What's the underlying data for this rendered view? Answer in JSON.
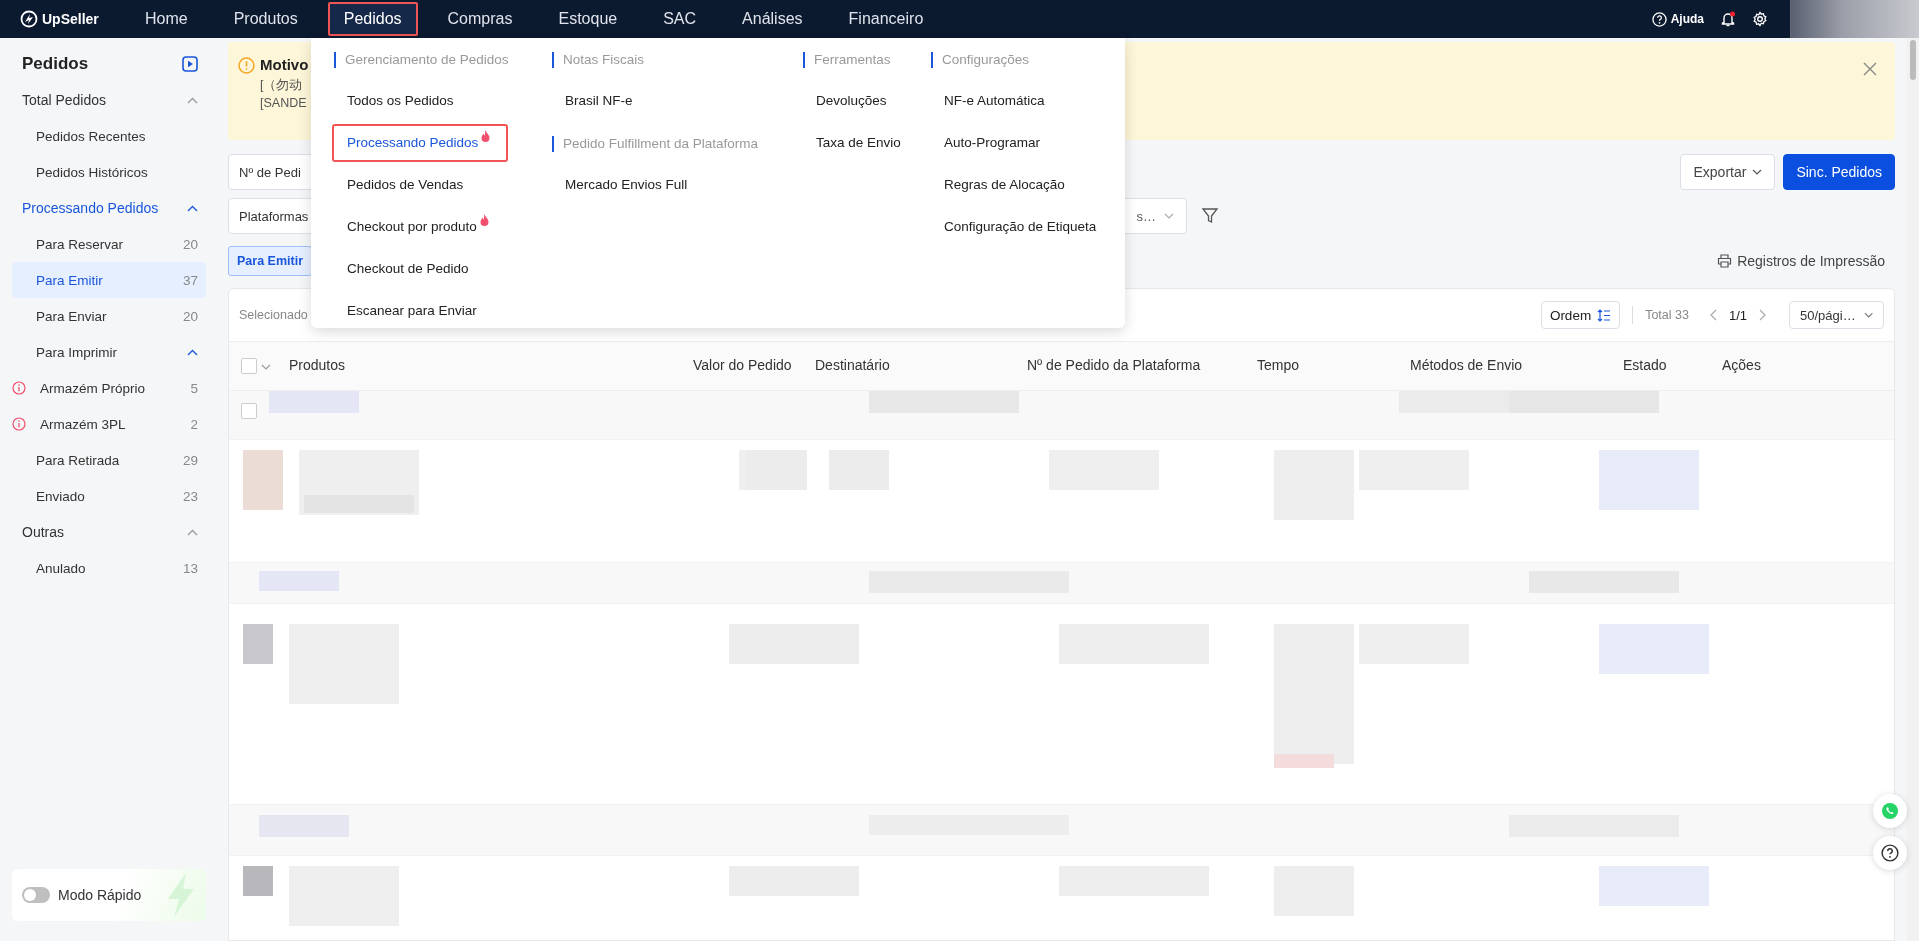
{
  "topbar": {
    "logo": "UpSeller",
    "nav": [
      {
        "label": "Home",
        "selected": false
      },
      {
        "label": "Produtos",
        "selected": false
      },
      {
        "label": "Pedidos",
        "selected": true
      },
      {
        "label": "Compras",
        "selected": false
      },
      {
        "label": "Estoque",
        "selected": false
      },
      {
        "label": "SAC",
        "selected": false
      },
      {
        "label": "Análises",
        "selected": false
      },
      {
        "label": "Financeiro",
        "selected": false
      }
    ],
    "help": "Ajuda",
    "notification_dot": true
  },
  "sidebar": {
    "title": "Pedidos",
    "groups": [
      {
        "label": "Total Pedidos",
        "active": false,
        "expanded": true,
        "children": [
          {
            "label": "Pedidos Recentes",
            "selected": false
          },
          {
            "label": "Pedidos Históricos",
            "selected": false
          }
        ]
      },
      {
        "label": "Processando Pedidos",
        "active": true,
        "expanded": true,
        "children": [
          {
            "label": "Para Reservar",
            "count": "20",
            "selected": false
          },
          {
            "label": "Para Emitir",
            "count": "37",
            "selected": true
          },
          {
            "label": "Para Enviar",
            "count": "20",
            "selected": false
          },
          {
            "label": "Para Imprimir",
            "selected": false,
            "expanded": true,
            "children": [
              {
                "label": "Armazém Próprio",
                "count": "5",
                "warning": true
              },
              {
                "label": "Armazém 3PL",
                "count": "2",
                "warning": true
              }
            ]
          },
          {
            "label": "Para Retirada",
            "count": "29",
            "selected": false
          },
          {
            "label": "Enviado",
            "count": "23",
            "selected": false
          }
        ]
      },
      {
        "label": "Outras",
        "active": false,
        "expanded": true,
        "children": [
          {
            "label": "Anulado",
            "count": "13",
            "selected": false
          }
        ]
      }
    ],
    "quick_mode": {
      "label": "Modo Rápido",
      "on": false
    }
  },
  "banner": {
    "title": "Motivo",
    "lines": [
      "[（勿动",
      "[SANDE"
    ]
  },
  "mega_menu": {
    "columns": [
      {
        "sections": [
          {
            "heading": "Gerenciamento de Pedidos",
            "items": [
              {
                "label": "Todos os Pedidos",
                "selected": false,
                "hot": false
              },
              {
                "label": "Processando Pedidos",
                "selected": true,
                "hot": true
              },
              {
                "label": "Pedidos de Vendas",
                "selected": false,
                "hot": false
              },
              {
                "label": "Checkout por produto",
                "selected": false,
                "hot": true
              },
              {
                "label": "Checkout de Pedido",
                "selected": false,
                "hot": false
              },
              {
                "label": "Escanear para Enviar",
                "selected": false,
                "hot": false
              }
            ]
          }
        ]
      },
      {
        "sections": [
          {
            "heading": "Notas Fiscais",
            "items": [
              {
                "label": "Brasil NF-e",
                "selected": false,
                "hot": false
              }
            ]
          },
          {
            "heading": "Pedido Fulfillment da Plataforma",
            "items": [
              {
                "label": "Mercado Envios Full",
                "selected": false,
                "hot": false
              }
            ]
          }
        ]
      },
      {
        "sections": [
          {
            "heading": "Ferramentas",
            "items": [
              {
                "label": "Devoluções",
                "selected": false,
                "hot": false
              },
              {
                "label": "Taxa de Envio",
                "selected": false,
                "hot": false
              }
            ]
          }
        ]
      },
      {
        "sections": [
          {
            "heading": "Configurações",
            "items": [
              {
                "label": "NF-e Automática",
                "selected": false,
                "hot": false
              },
              {
                "label": "Auto-Programar",
                "selected": false,
                "hot": false
              },
              {
                "label": "Regras de Alocação",
                "selected": false,
                "hot": false
              },
              {
                "label": "Configuração de Etiqueta",
                "selected": false,
                "hot": false
              }
            ]
          }
        ]
      }
    ]
  },
  "toolbar": {
    "order_search": "Nº de Pedi",
    "platforms": "Plataformas",
    "select_tail": "s…",
    "export": "Exportar",
    "sync": "Sinc. Pedidos"
  },
  "status_tabs": [
    {
      "label": "Para Emitir",
      "selected": true
    }
  ],
  "print_log": "Registros de Impressão",
  "table": {
    "header_checked": false,
    "first_row_checked": false,
    "selection_text": "Selecionado",
    "order_button": "Ordem",
    "total": "Total 33",
    "page": "1/1",
    "page_size": "50/pági…",
    "columns": [
      "Produtos",
      "Valor do Pedido",
      "Destinatário",
      "Nº de Pedido da Plataforma",
      "Tempo",
      "Métodos de Envio",
      "Estado",
      "Ações"
    ]
  }
}
